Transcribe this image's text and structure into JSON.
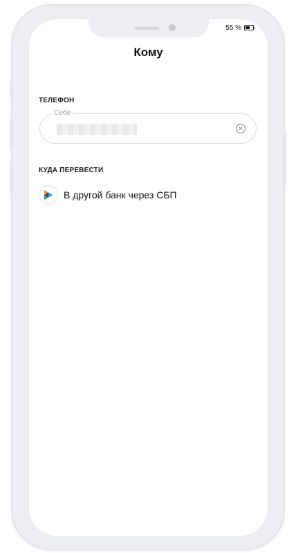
{
  "status_bar": {
    "battery_percent": "55 %",
    "battery_level": 0.55
  },
  "header": {
    "title": "Кому"
  },
  "phone_section": {
    "label": "ТЕЛЕФОН",
    "field_caption": "Себе",
    "value_hidden": true,
    "clear_icon": "clear-circle-x-icon"
  },
  "destination_section": {
    "label": "КУДА ПЕРЕВЕСТИ",
    "options": [
      {
        "icon": "sbp-logo-icon",
        "label": "В другой банк через СБП"
      }
    ]
  },
  "colors": {
    "frame": "#eceef1",
    "border": "#d6d9de",
    "caption": "#9aa0a8",
    "sbp_orange": "#f7941d",
    "sbp_purple": "#5b2d90",
    "sbp_blue": "#1ba0e0",
    "sbp_green": "#2fa84f"
  }
}
